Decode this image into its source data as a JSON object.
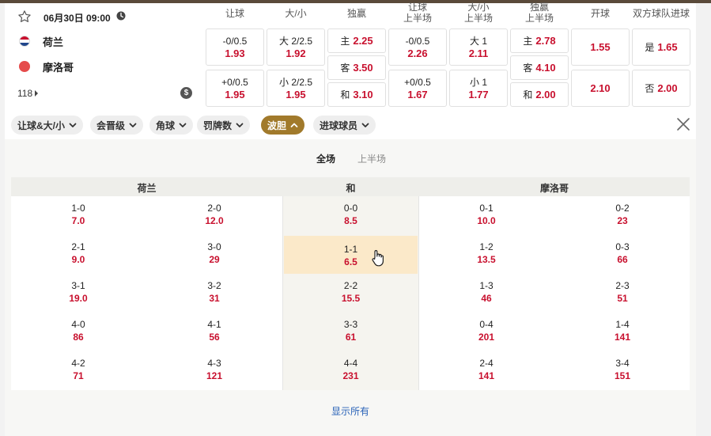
{
  "match": {
    "time": "06月30日 09:00",
    "home": "荷兰",
    "away": "摩洛哥",
    "market_count": "118",
    "colors": {
      "odd": "#c8102e",
      "accent": "#a17a2b",
      "link": "#2a63b8"
    }
  },
  "columns": [
    "让球",
    "大/小",
    "独赢",
    "让球\n上半场",
    "大/小\n上半场",
    "独赢\n上半场",
    "开球",
    "双方球队进球"
  ],
  "odds": {
    "handicap": [
      {
        "line": "-0/0.5",
        "odd": "1.93"
      },
      {
        "line": "+0/0.5",
        "odd": "1.95"
      }
    ],
    "over_under": [
      {
        "line": "大 2/2.5",
        "odd": "1.92"
      },
      {
        "line": "小 2/2.5",
        "odd": "1.95"
      }
    ],
    "moneyline": [
      {
        "label": "主",
        "odd": "2.25"
      },
      {
        "label": "客",
        "odd": "3.50"
      },
      {
        "label": "和",
        "odd": "3.10"
      }
    ],
    "handicap_1h": [
      {
        "line": "-0/0.5",
        "odd": "2.26"
      },
      {
        "line": "+0/0.5",
        "odd": "1.67"
      }
    ],
    "over_under_1h": [
      {
        "line": "大 1",
        "odd": "2.11"
      },
      {
        "line": "小 1",
        "odd": "1.77"
      }
    ],
    "moneyline_1h": [
      {
        "label": "主",
        "odd": "2.78"
      },
      {
        "label": "客",
        "odd": "4.10"
      },
      {
        "label": "和",
        "odd": "2.00"
      }
    ],
    "kickoff": [
      {
        "odd": "1.55"
      },
      {
        "odd": "2.10"
      }
    ],
    "both_score": [
      {
        "label": "是",
        "odd": "1.65"
      },
      {
        "label": "否",
        "odd": "2.00"
      }
    ]
  },
  "filters": [
    {
      "label": "让球&大/小",
      "active": false
    },
    {
      "label": "会晋级",
      "active": false
    },
    {
      "label": "角球",
      "active": false
    },
    {
      "label": "罚牌数",
      "active": false
    },
    {
      "label": "波胆",
      "active": true
    },
    {
      "label": "进球球员",
      "active": false
    }
  ],
  "tabs": [
    "全场",
    "上半场"
  ],
  "correct_score": {
    "headers": {
      "home": "荷兰",
      "draw": "和",
      "away": "摩洛哥"
    },
    "home": [
      [
        {
          "s": "1-0",
          "o": "7.0"
        },
        {
          "s": "2-0",
          "o": "12.0"
        }
      ],
      [
        {
          "s": "2-1",
          "o": "9.0"
        },
        {
          "s": "3-0",
          "o": "29"
        }
      ],
      [
        {
          "s": "3-1",
          "o": "19.0"
        },
        {
          "s": "3-2",
          "o": "31"
        }
      ],
      [
        {
          "s": "4-0",
          "o": "86"
        },
        {
          "s": "4-1",
          "o": "56"
        }
      ],
      [
        {
          "s": "4-2",
          "o": "71"
        },
        {
          "s": "4-3",
          "o": "121"
        }
      ]
    ],
    "draw": [
      {
        "s": "0-0",
        "o": "8.5"
      },
      {
        "s": "1-1",
        "o": "6.5"
      },
      {
        "s": "2-2",
        "o": "15.5"
      },
      {
        "s": "3-3",
        "o": "61"
      },
      {
        "s": "4-4",
        "o": "231"
      }
    ],
    "away": [
      [
        {
          "s": "0-1",
          "o": "10.0"
        },
        {
          "s": "0-2",
          "o": "23"
        }
      ],
      [
        {
          "s": "1-2",
          "o": "13.5"
        },
        {
          "s": "0-3",
          "o": "66"
        }
      ],
      [
        {
          "s": "1-3",
          "o": "46"
        },
        {
          "s": "2-3",
          "o": "51"
        }
      ],
      [
        {
          "s": "0-4",
          "o": "201"
        },
        {
          "s": "1-4",
          "o": "141"
        }
      ],
      [
        {
          "s": "2-4",
          "o": "141"
        },
        {
          "s": "3-4",
          "o": "151"
        }
      ]
    ]
  },
  "show_all": "显示所有"
}
